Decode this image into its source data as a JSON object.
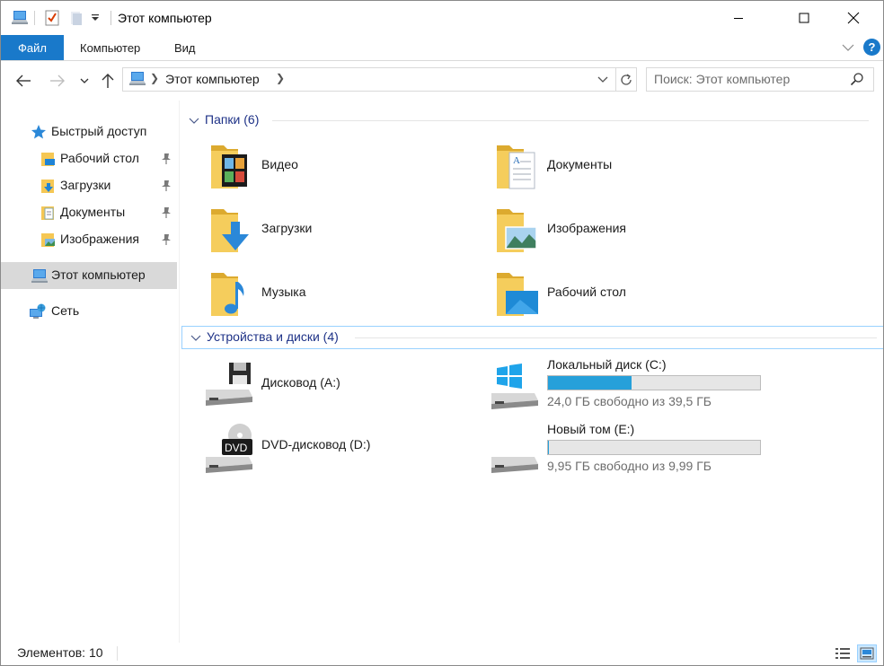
{
  "window": {
    "title": "Этот компьютер"
  },
  "ribbon": {
    "tabs": [
      "Файл",
      "Компьютер",
      "Вид"
    ]
  },
  "address": {
    "path": "Этот компьютер"
  },
  "search": {
    "placeholder": "Поиск: Этот компьютер"
  },
  "nav": {
    "quick_access": "Быстрый доступ",
    "pinned": [
      "Рабочий стол",
      "Загрузки",
      "Документы",
      "Изображения"
    ],
    "this_pc": "Этот компьютер",
    "network": "Сеть"
  },
  "folders": {
    "header": "Папки (6)",
    "items": [
      "Видео",
      "Документы",
      "Загрузки",
      "Изображения",
      "Музыка",
      "Рабочий стол"
    ]
  },
  "devices": {
    "header": "Устройства и диски (4)",
    "items": [
      {
        "name": "Дисковод (A:)"
      },
      {
        "name": "Локальный диск (C:)",
        "free_text": "24,0 ГБ свободно из 39,5 ГБ",
        "used_fraction": 0.392
      },
      {
        "name": "DVD-дисковод (D:)"
      },
      {
        "name": "Новый том (E:)",
        "free_text": "9,95 ГБ свободно из 9,99 ГБ",
        "used_fraction": 0.004
      }
    ]
  },
  "status": {
    "items_count": "Элементов: 10"
  },
  "colors": {
    "accent": "#1979ca",
    "folder_header": "#1e3287",
    "usage_bar": "#26a0da",
    "selection": "#d9d9d9"
  }
}
